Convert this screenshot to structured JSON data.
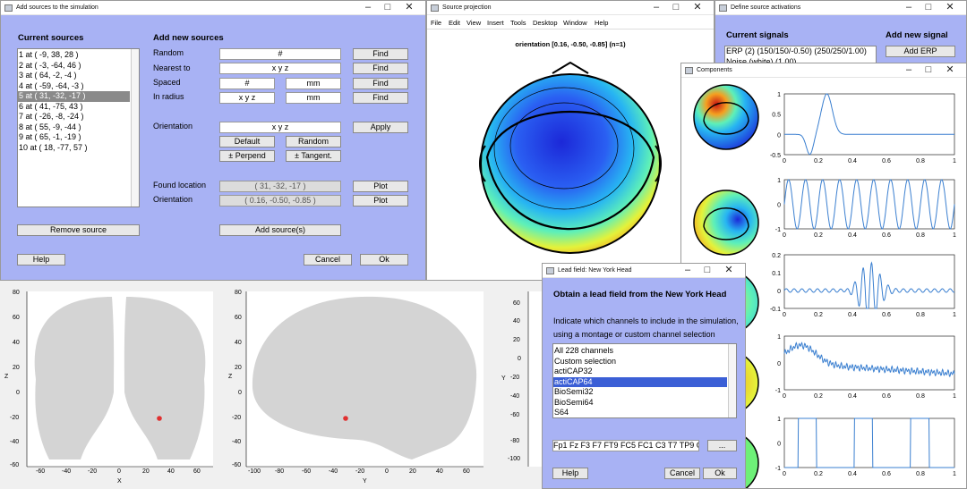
{
  "win1": {
    "title": "Add sources to the simulation",
    "current_sources": "Current sources",
    "add_new": "Add new sources",
    "sources": [
      "1 at ( -9, 38, 28 )",
      "2 at ( -3, -64, 46 )",
      "3 at ( 64, -2, -4 )",
      "4 at ( -59, -64, -3 )",
      "5 at ( 31, -32, -17 )",
      "6 at ( 41, -75, 43 )",
      "7 at ( -26, -8, -24 )",
      "8 at ( 55, -9, -44 )",
      "9 at ( 65, -1, -19 )",
      "10 at ( 18, -77, 57 )"
    ],
    "random": "Random",
    "nearest": "Nearest to",
    "spaced": "Spaced",
    "in_radius": "In radius",
    "hash": "#",
    "xyz": "x y z",
    "mm": "mm",
    "find": "Find",
    "orientation": "Orientation",
    "apply": "Apply",
    "default": "Default",
    "random_btn": "Random",
    "perpend": "± Perpend",
    "tangent": "± Tangent.",
    "found_location": "Found location",
    "found_loc_val": "( 31, -32, -17 )",
    "orient_val": "( 0.16, -0.50, -0.85 )",
    "plot": "Plot",
    "remove_source": "Remove source",
    "add_sources": "Add source(s)",
    "help": "Help",
    "cancel": "Cancel",
    "ok": "Ok"
  },
  "win2": {
    "title": "Source projection",
    "menus": [
      "File",
      "Edit",
      "View",
      "Insert",
      "Tools",
      "Desktop",
      "Window",
      "Help"
    ],
    "plot_title": "orientation [0.16, -0.50, -0.85] (n=1)"
  },
  "win3": {
    "title": "Define source activations",
    "current_signals": "Current signals",
    "signals": [
      "ERP (2) (150/150/-0.50) (250/250/1.00)",
      "Noise (white) (1.00)"
    ],
    "add_new_signal": "Add new signal",
    "add_erp": "Add ERP"
  },
  "win4": {
    "title": "Components",
    "ticks_x": [
      "0",
      "0.2",
      "0.4",
      "0.6",
      "0.8",
      "1"
    ],
    "yt1": [
      "1",
      "0.5",
      "0",
      "-0.5"
    ],
    "yt2": [
      "1",
      "0",
      "-1"
    ],
    "yt3": [
      "0.2",
      "0.1",
      "0",
      "-0.1"
    ],
    "yt4": [
      "1",
      "0",
      "-1"
    ],
    "yt5": [
      "1",
      "0",
      "-1"
    ]
  },
  "win5": {
    "title": "Lead field: New York Head",
    "heading": "Obtain a lead field from the New York Head",
    "desc1": "Indicate which channels to include in the simulation,",
    "desc2": "using a montage or custom channel selection",
    "options": [
      "All 228 channels",
      "Custom selection",
      "actiCAP32",
      "actiCAP64",
      "BioSemi32",
      "BioSemi64",
      "S64"
    ],
    "channels": "Fp1 Fz F3 F7 FT9 FC5 FC1 C3 T7 TP9 CP5",
    "dots": "...",
    "help": "Help",
    "cancel": "Cancel",
    "ok": "Ok"
  },
  "brain": {
    "x1": [
      "-60",
      "-40",
      "-20",
      "0",
      "20",
      "40",
      "60"
    ],
    "xl1": "X",
    "zl": "Z",
    "x2": [
      "-100",
      "-80",
      "-60",
      "-40",
      "-20",
      "0",
      "20",
      "40",
      "60"
    ],
    "xl2": "Y",
    "zt": [
      "80",
      "60",
      "40",
      "20",
      "0",
      "-20",
      "-40",
      "-60"
    ],
    "x3zt": [
      "60",
      "40",
      "20",
      "0",
      "-20",
      "-40",
      "-60",
      "-80",
      "-100"
    ],
    "yl3": "Y"
  },
  "colors": {
    "panel": "#a8b2f4",
    "selection": "#3b5fd6",
    "source_dot": "#e03030"
  }
}
